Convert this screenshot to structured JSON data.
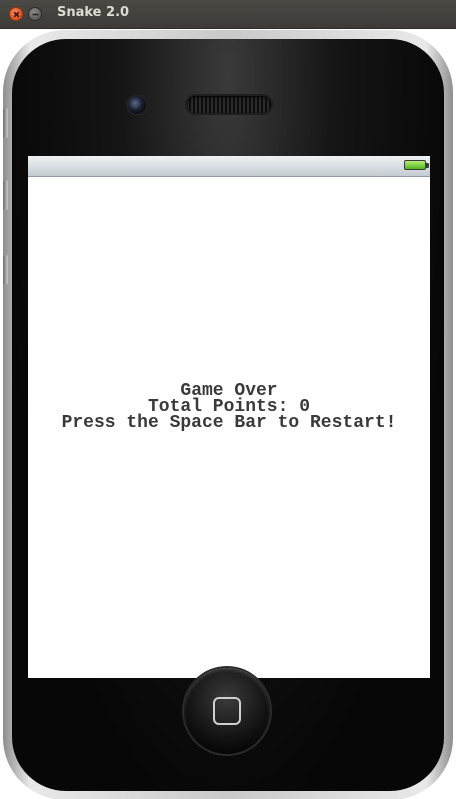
{
  "window": {
    "title": "Snake 2.0"
  },
  "status_bar": {
    "battery_icon": "battery-full-icon",
    "battery_color": "#4fb51c"
  },
  "game": {
    "line1": "Game Over",
    "line2": "Total Points: 0",
    "line3": "Press the Space Bar to Restart!"
  },
  "icons": {
    "close": "close-icon",
    "minimize": "minimize-icon",
    "home": "home-button-icon",
    "camera": "camera-icon",
    "speaker": "speaker-grille-icon"
  },
  "colors": {
    "titlebar": "#3c3b37",
    "close_button": "#e0501e",
    "screen_background": "#ffffff",
    "message_text": "#3a3a3a"
  }
}
